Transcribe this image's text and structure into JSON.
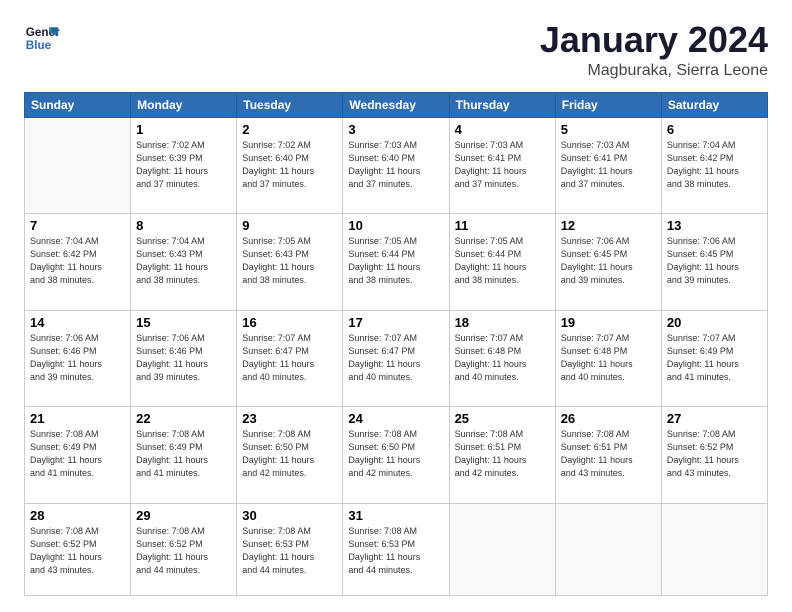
{
  "header": {
    "logo_line1": "General",
    "logo_line2": "Blue",
    "month": "January 2024",
    "location": "Magburaka, Sierra Leone"
  },
  "weekdays": [
    "Sunday",
    "Monday",
    "Tuesday",
    "Wednesday",
    "Thursday",
    "Friday",
    "Saturday"
  ],
  "weeks": [
    [
      {
        "day": "",
        "info": ""
      },
      {
        "day": "1",
        "info": "Sunrise: 7:02 AM\nSunset: 6:39 PM\nDaylight: 11 hours\nand 37 minutes."
      },
      {
        "day": "2",
        "info": "Sunrise: 7:02 AM\nSunset: 6:40 PM\nDaylight: 11 hours\nand 37 minutes."
      },
      {
        "day": "3",
        "info": "Sunrise: 7:03 AM\nSunset: 6:40 PM\nDaylight: 11 hours\nand 37 minutes."
      },
      {
        "day": "4",
        "info": "Sunrise: 7:03 AM\nSunset: 6:41 PM\nDaylight: 11 hours\nand 37 minutes."
      },
      {
        "day": "5",
        "info": "Sunrise: 7:03 AM\nSunset: 6:41 PM\nDaylight: 11 hours\nand 37 minutes."
      },
      {
        "day": "6",
        "info": "Sunrise: 7:04 AM\nSunset: 6:42 PM\nDaylight: 11 hours\nand 38 minutes."
      }
    ],
    [
      {
        "day": "7",
        "info": "Sunrise: 7:04 AM\nSunset: 6:42 PM\nDaylight: 11 hours\nand 38 minutes."
      },
      {
        "day": "8",
        "info": "Sunrise: 7:04 AM\nSunset: 6:43 PM\nDaylight: 11 hours\nand 38 minutes."
      },
      {
        "day": "9",
        "info": "Sunrise: 7:05 AM\nSunset: 6:43 PM\nDaylight: 11 hours\nand 38 minutes."
      },
      {
        "day": "10",
        "info": "Sunrise: 7:05 AM\nSunset: 6:44 PM\nDaylight: 11 hours\nand 38 minutes."
      },
      {
        "day": "11",
        "info": "Sunrise: 7:05 AM\nSunset: 6:44 PM\nDaylight: 11 hours\nand 38 minutes."
      },
      {
        "day": "12",
        "info": "Sunrise: 7:06 AM\nSunset: 6:45 PM\nDaylight: 11 hours\nand 39 minutes."
      },
      {
        "day": "13",
        "info": "Sunrise: 7:06 AM\nSunset: 6:45 PM\nDaylight: 11 hours\nand 39 minutes."
      }
    ],
    [
      {
        "day": "14",
        "info": "Sunrise: 7:06 AM\nSunset: 6:46 PM\nDaylight: 11 hours\nand 39 minutes."
      },
      {
        "day": "15",
        "info": "Sunrise: 7:06 AM\nSunset: 6:46 PM\nDaylight: 11 hours\nand 39 minutes."
      },
      {
        "day": "16",
        "info": "Sunrise: 7:07 AM\nSunset: 6:47 PM\nDaylight: 11 hours\nand 40 minutes."
      },
      {
        "day": "17",
        "info": "Sunrise: 7:07 AM\nSunset: 6:47 PM\nDaylight: 11 hours\nand 40 minutes."
      },
      {
        "day": "18",
        "info": "Sunrise: 7:07 AM\nSunset: 6:48 PM\nDaylight: 11 hours\nand 40 minutes."
      },
      {
        "day": "19",
        "info": "Sunrise: 7:07 AM\nSunset: 6:48 PM\nDaylight: 11 hours\nand 40 minutes."
      },
      {
        "day": "20",
        "info": "Sunrise: 7:07 AM\nSunset: 6:49 PM\nDaylight: 11 hours\nand 41 minutes."
      }
    ],
    [
      {
        "day": "21",
        "info": "Sunrise: 7:08 AM\nSunset: 6:49 PM\nDaylight: 11 hours\nand 41 minutes."
      },
      {
        "day": "22",
        "info": "Sunrise: 7:08 AM\nSunset: 6:49 PM\nDaylight: 11 hours\nand 41 minutes."
      },
      {
        "day": "23",
        "info": "Sunrise: 7:08 AM\nSunset: 6:50 PM\nDaylight: 11 hours\nand 42 minutes."
      },
      {
        "day": "24",
        "info": "Sunrise: 7:08 AM\nSunset: 6:50 PM\nDaylight: 11 hours\nand 42 minutes."
      },
      {
        "day": "25",
        "info": "Sunrise: 7:08 AM\nSunset: 6:51 PM\nDaylight: 11 hours\nand 42 minutes."
      },
      {
        "day": "26",
        "info": "Sunrise: 7:08 AM\nSunset: 6:51 PM\nDaylight: 11 hours\nand 43 minutes."
      },
      {
        "day": "27",
        "info": "Sunrise: 7:08 AM\nSunset: 6:52 PM\nDaylight: 11 hours\nand 43 minutes."
      }
    ],
    [
      {
        "day": "28",
        "info": "Sunrise: 7:08 AM\nSunset: 6:52 PM\nDaylight: 11 hours\nand 43 minutes."
      },
      {
        "day": "29",
        "info": "Sunrise: 7:08 AM\nSunset: 6:52 PM\nDaylight: 11 hours\nand 44 minutes."
      },
      {
        "day": "30",
        "info": "Sunrise: 7:08 AM\nSunset: 6:53 PM\nDaylight: 11 hours\nand 44 minutes."
      },
      {
        "day": "31",
        "info": "Sunrise: 7:08 AM\nSunset: 6:53 PM\nDaylight: 11 hours\nand 44 minutes."
      },
      {
        "day": "",
        "info": ""
      },
      {
        "day": "",
        "info": ""
      },
      {
        "day": "",
        "info": ""
      }
    ]
  ]
}
